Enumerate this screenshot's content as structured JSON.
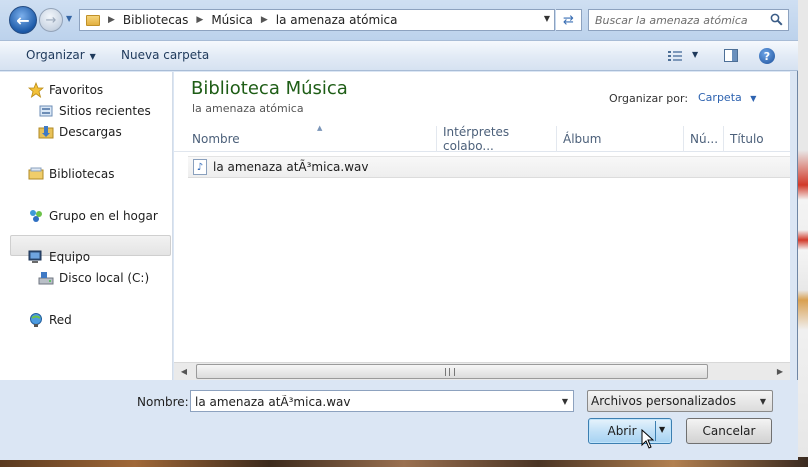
{
  "address": {
    "crumbs": [
      "Bibliotecas",
      "Música",
      "la amenaza atómica"
    ]
  },
  "search": {
    "placeholder": "Buscar la amenaza atómica"
  },
  "toolbar": {
    "organize_label": "Organizar",
    "new_folder_label": "Nueva carpeta"
  },
  "nav": {
    "favorites": "Favoritos",
    "recent": "Sitios recientes",
    "downloads": "Descargas",
    "libraries": "Bibliotecas",
    "homegroup": "Grupo en el hogar",
    "computer": "Equipo",
    "local_disk": "Disco local (C:)",
    "network": "Red"
  },
  "library": {
    "title": "Biblioteca Música",
    "subtitle": "la amenaza atómica",
    "arrange_label": "Organizar por:",
    "arrange_value": "Carpeta"
  },
  "columns": [
    "Nombre",
    "Intérpretes colabo...",
    "Álbum",
    "Nú...",
    "Título"
  ],
  "files": [
    {
      "name": "la amenaza atÃ³mica.wav"
    }
  ],
  "footer": {
    "name_label": "Nombre:",
    "name_value": "la amenaza atÃ³mica.wav",
    "filter_value": "Archivos personalizados",
    "open_label": "Abrir",
    "cancel_label": "Cancelar"
  }
}
